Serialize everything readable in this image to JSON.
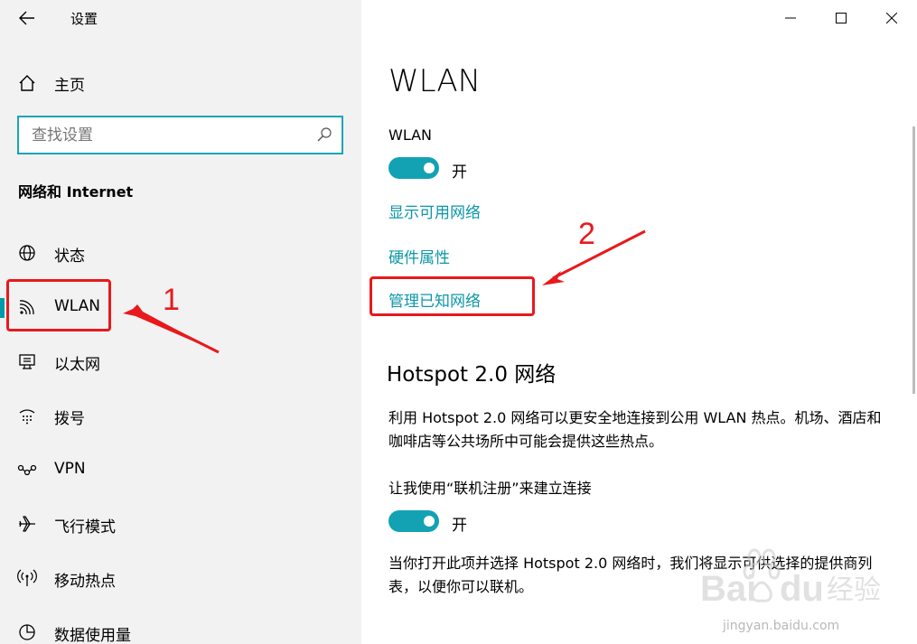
{
  "window": {
    "title": "设置",
    "controls": [
      "minimize-icon",
      "maximize-icon",
      "close-icon"
    ]
  },
  "sidebar": {
    "home_label": "主页",
    "search_placeholder": "查找设置",
    "section_title": "网络和 Internet",
    "items": [
      {
        "label": "状态",
        "icon": "globe-icon"
      },
      {
        "label": "WLAN",
        "icon": "wifi-icon",
        "active": true
      },
      {
        "label": "以太网",
        "icon": "ethernet-icon"
      },
      {
        "label": "拨号",
        "icon": "dialup-icon"
      },
      {
        "label": "VPN",
        "icon": "vpn-icon"
      },
      {
        "label": "飞行模式",
        "icon": "airplane-icon"
      },
      {
        "label": "移动热点",
        "icon": "hotspot-icon"
      },
      {
        "label": "数据使用量",
        "icon": "data-usage-icon"
      }
    ]
  },
  "main": {
    "title": "WLAN",
    "wlan_label": "WLAN",
    "wlan_toggle_text": "开",
    "links": {
      "show_networks": "显示可用网络",
      "hardware_props": "硬件属性",
      "manage_known": "管理已知网络"
    },
    "hotspot_title": "Hotspot 2.0 网络",
    "hotspot_desc": "利用 Hotspot 2.0 网络可以更安全地连接到公用 WLAN 热点。机场、酒店和咖啡店等公共场所中可能会提供这些热点。",
    "signup_label": "让我使用“联机注册”来建立连接",
    "signup_toggle_text": "开",
    "signup_desc": "当你打开此项并选择 Hotspot 2.0 网络时，我们将显示可供选择的提供商列表，以便你可以联机。"
  },
  "annotations": {
    "step1": "1",
    "step2": "2",
    "color": "#e8191c"
  },
  "watermark": {
    "text": "jingyan.baidu.com"
  },
  "colors": {
    "accent": "#12a2b4",
    "link": "#0d97a8",
    "sidebar_bg": "#f2f2f2"
  }
}
